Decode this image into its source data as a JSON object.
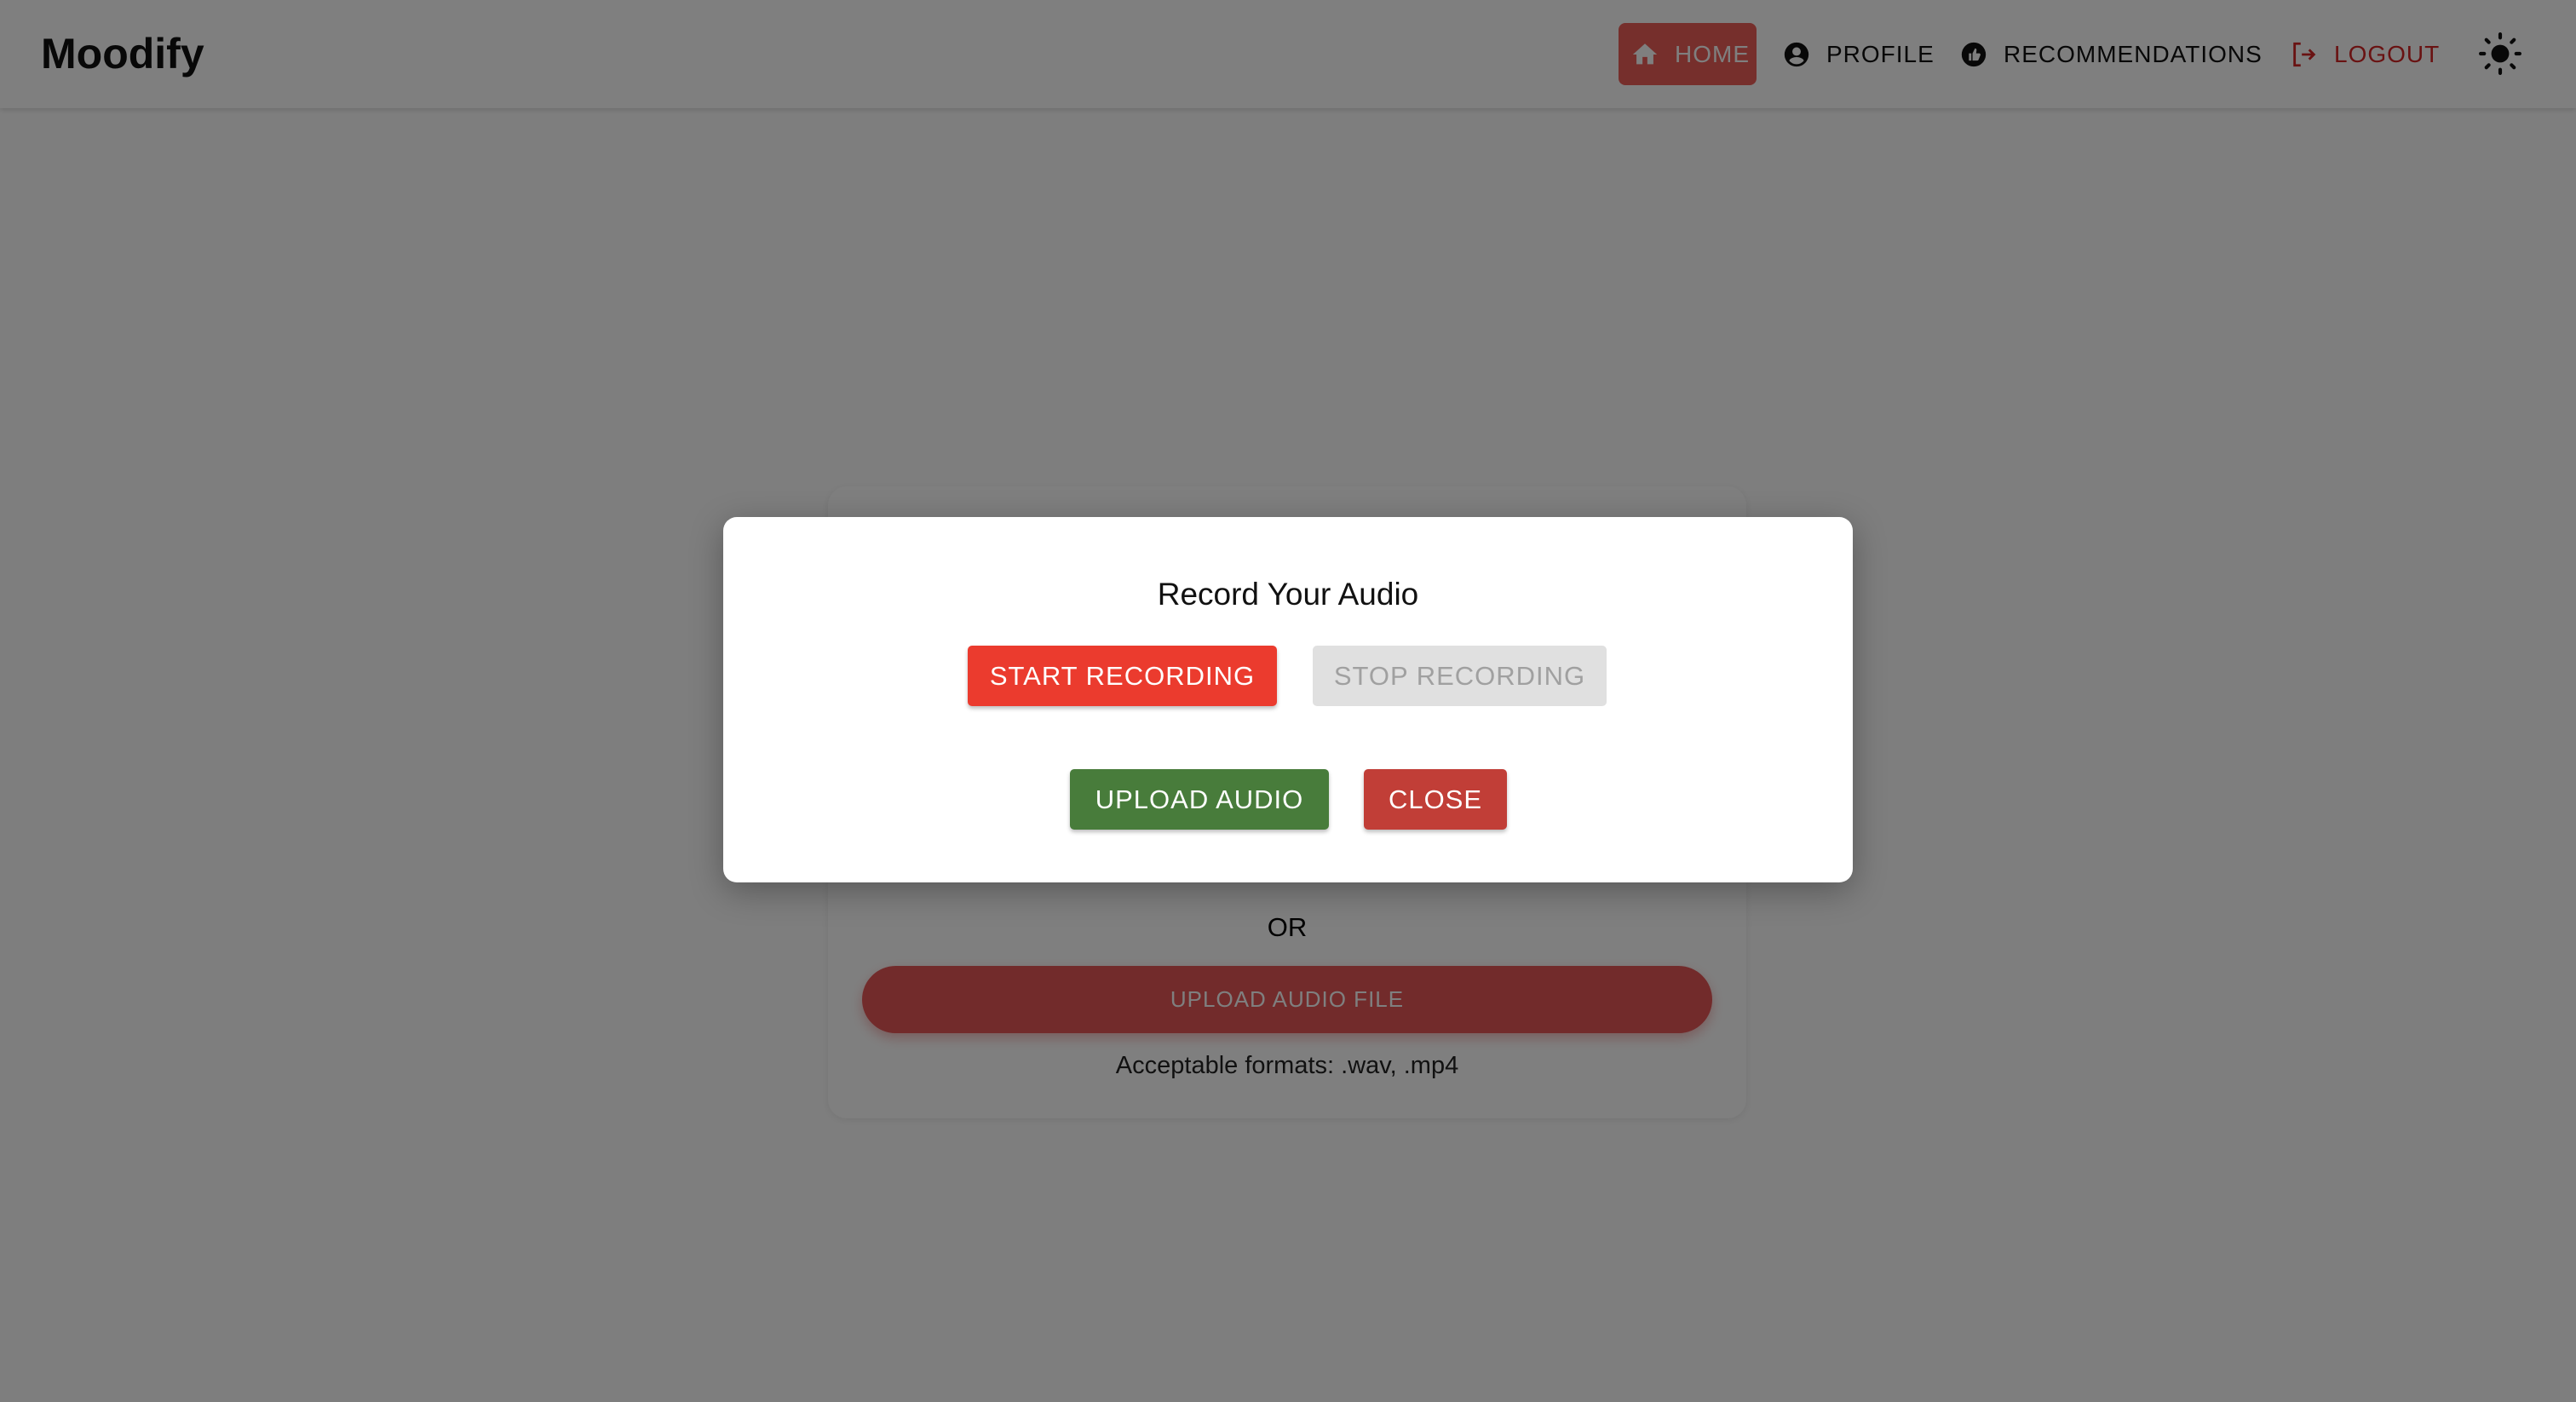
{
  "header": {
    "logo": "Moodify",
    "nav": [
      {
        "label": "HOME",
        "icon": "home-icon",
        "active": true
      },
      {
        "label": "PROFILE",
        "icon": "account-circle-icon"
      },
      {
        "label": "RECOMMENDATIONS",
        "icon": "thumb-up-icon"
      },
      {
        "label": "LOGOUT",
        "icon": "logout-icon"
      }
    ],
    "theme_icon": "sun-icon"
  },
  "card": {
    "or": "OR",
    "upload_file": "UPLOAD AUDIO FILE",
    "formats": "Acceptable formats: .wav, .mp4"
  },
  "modal": {
    "title": "Record Your Audio",
    "start": "START RECORDING",
    "stop": "STOP RECORDING",
    "upload": "UPLOAD AUDIO",
    "close": "CLOSE"
  },
  "colors": {
    "start": "#eb3b2e",
    "upload": "#487c3b",
    "close": "#c13e37",
    "accent": "#ec5e58"
  }
}
